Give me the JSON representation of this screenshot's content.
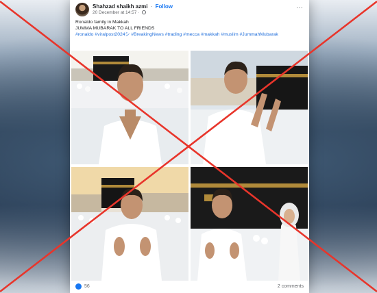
{
  "post": {
    "author": "Shahzad shaikh azmi",
    "follow_label": "Follow",
    "separator": "·",
    "timestamp": "20 December at 14:57 ·",
    "more_icon": "⋯",
    "caption_line1": "Ronaldo family in Makkah",
    "caption_line2": "JUMMA MUBARAK TO ALL FRIENDS",
    "hashtags": "#ronaldo #viralpost2024シ #BreakingNews #trading #mecca #makkah #muslim #JummahMubarak",
    "reaction_count": "56",
    "comments_label": "2 comments"
  },
  "photos": [
    {
      "name": "photo-man-in-ihram-front-of-kaaba"
    },
    {
      "name": "photo-man-praying-near-kaaba"
    },
    {
      "name": "photo-man-raising-hands-at-sunset"
    },
    {
      "name": "photo-man-and-woman-in-front-of-kaaba"
    }
  ],
  "overlay": {
    "mark": "red-x-cross",
    "color": "#e8352b"
  },
  "colors": {
    "link": "#1877f2",
    "hashtag": "#216fdb",
    "text": "#1c1e21",
    "muted": "#65676b"
  }
}
